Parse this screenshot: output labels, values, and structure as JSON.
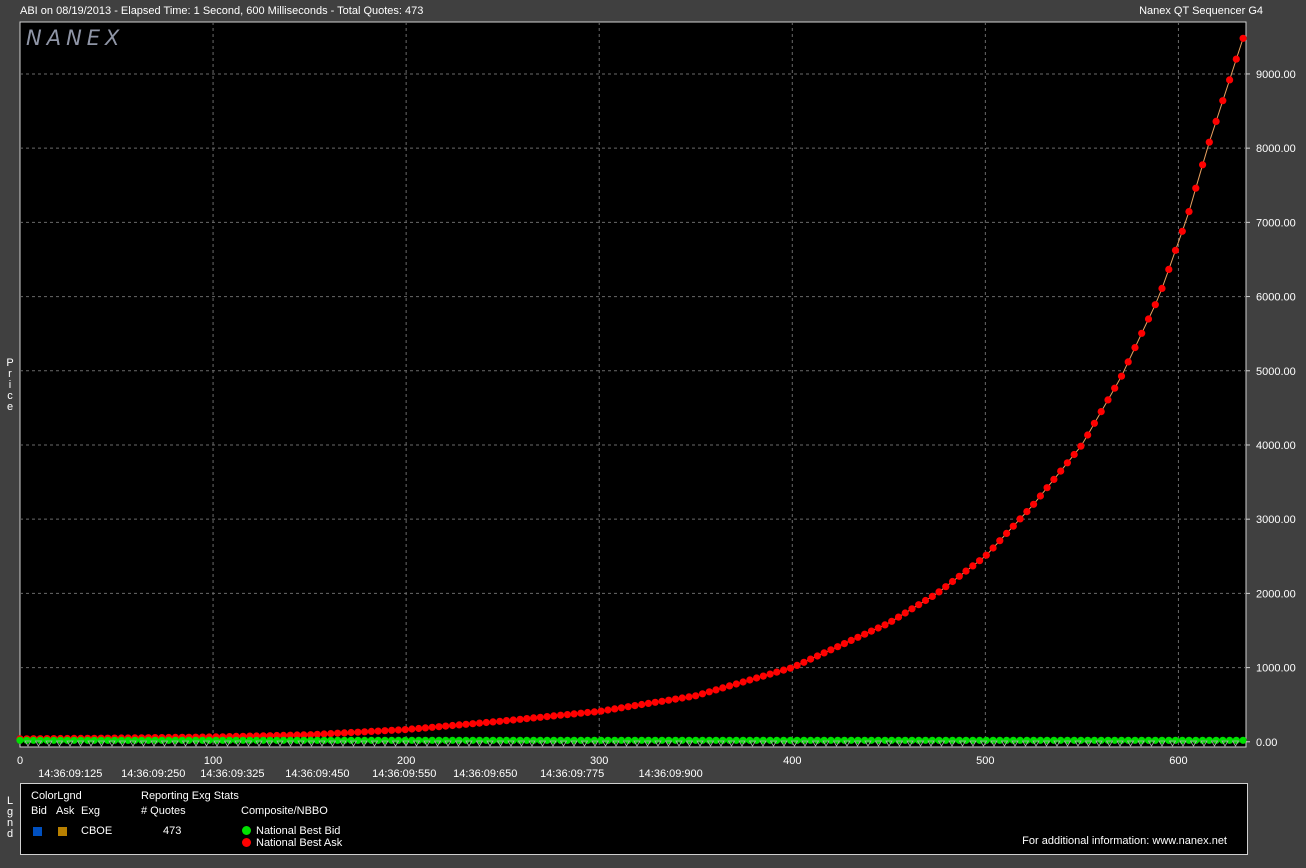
{
  "header": {
    "left_title": "ABI on 08/19/2013  -  Elapsed Time: 1 Second, 600 Milliseconds  -  Total Quotes: 473",
    "right_title": "Nanex QT Sequencer G4"
  },
  "watermark": "NANEX",
  "side_labels": {
    "price": "Price",
    "legend": "Lgnd"
  },
  "colors": {
    "background": "#404040",
    "plot_bg": "#000000",
    "grid": "#6a6a6a",
    "bid": "#0050c0",
    "ask": "#b88000",
    "best_bid": "#00e000",
    "best_ask": "#ff0000"
  },
  "chart_data": {
    "type": "scatter",
    "title": "",
    "xlabel": "",
    "ylabel": "Price",
    "xlim": [
      0,
      635
    ],
    "ylim": [
      -70,
      9700
    ],
    "x_ticks": [
      0,
      100,
      200,
      300,
      400,
      500,
      600
    ],
    "y_ticks": [
      "0.00",
      "1000.00",
      "2000.00",
      "3000.00",
      "4000.00",
      "5000.00",
      "6000.00",
      "7000.00",
      "8000.00",
      "9000.00"
    ],
    "time_labels": [
      {
        "x": 26,
        "label": "14:36:09:125"
      },
      {
        "x": 69,
        "label": "14:36:09:250"
      },
      {
        "x": 110,
        "label": "14:36:09:325"
      },
      {
        "x": 154,
        "label": "14:36:09:450"
      },
      {
        "x": 199,
        "label": "14:36:09:550"
      },
      {
        "x": 241,
        "label": "14:36:09:650"
      },
      {
        "x": 286,
        "label": "14:36:09:775"
      },
      {
        "x": 337,
        "label": "14:36:09:900"
      }
    ],
    "grid": true,
    "series": [
      {
        "name": "National Best Ask",
        "color": "#ff0000",
        "points": [
          [
            0,
            40
          ],
          [
            50,
            50
          ],
          [
            100,
            65
          ],
          [
            150,
            95
          ],
          [
            200,
            165
          ],
          [
            250,
            280
          ],
          [
            300,
            410
          ],
          [
            350,
            620
          ],
          [
            400,
            1000
          ],
          [
            450,
            1600
          ],
          [
            475,
            2000
          ],
          [
            500,
            2500
          ],
          [
            525,
            3200
          ],
          [
            550,
            4000
          ],
          [
            570,
            4900
          ],
          [
            590,
            6000
          ],
          [
            605,
            7100
          ],
          [
            615,
            8000
          ],
          [
            625,
            8800
          ],
          [
            635,
            9600
          ]
        ]
      },
      {
        "name": "National Best Bid",
        "color": "#00e000",
        "points": [
          [
            0,
            20
          ],
          [
            100,
            20
          ],
          [
            200,
            20
          ],
          [
            300,
            20
          ],
          [
            400,
            20
          ],
          [
            500,
            20
          ],
          [
            600,
            20
          ],
          [
            635,
            20
          ]
        ]
      }
    ]
  },
  "legend": {
    "colorlgnd_title": "ColorLgnd",
    "col_bid": "Bid",
    "col_ask": "Ask",
    "col_exg": "Exg",
    "stats_title": "Reporting Exg Stats",
    "quotes_header": "# Quotes",
    "composite_title": "Composite/NBBO",
    "exchange": "CBOE",
    "quotes": "473",
    "nbb_label": "National Best Bid",
    "nbo_label": "National Best Ask",
    "info": "For additional information: www.nanex.net"
  }
}
